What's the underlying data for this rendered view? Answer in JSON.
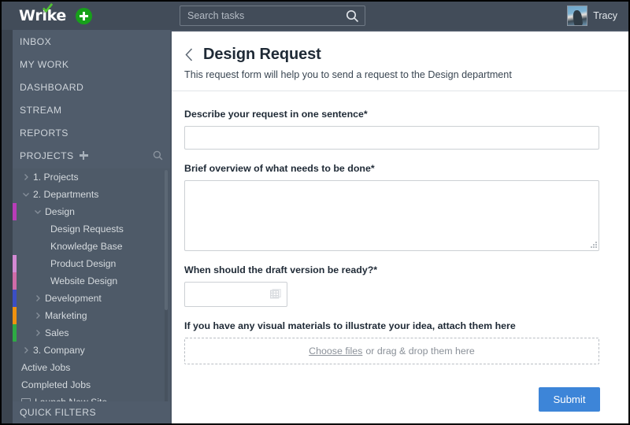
{
  "brand": {
    "logo_text": "Wrike",
    "accent_green": "#17a01a",
    "add_button_label": "+"
  },
  "search": {
    "placeholder": "Search tasks",
    "value": "",
    "icon": "search-icon"
  },
  "user": {
    "name": "Tracy",
    "avatar": "avatar-photo"
  },
  "sidebar": {
    "nav_items": [
      {
        "label": "INBOX"
      },
      {
        "label": "MY WORK"
      },
      {
        "label": "DASHBOARD"
      },
      {
        "label": "STREAM"
      },
      {
        "label": "REPORTS"
      }
    ],
    "projects_row": {
      "label": "PROJECTS",
      "add_icon": "plus-icon",
      "search_icon": "search-icon"
    },
    "tree": [
      {
        "label": "1. Projects",
        "level": 0,
        "chevron": "right",
        "color": ""
      },
      {
        "label": "2. Departments",
        "level": 0,
        "chevron": "down",
        "color": ""
      },
      {
        "label": "Design",
        "level": 1,
        "chevron": "down",
        "color": "#b83db8"
      },
      {
        "label": "Design Requests",
        "level": 2,
        "chevron": "none",
        "color": ""
      },
      {
        "label": "Knowledge Base",
        "level": 2,
        "chevron": "none",
        "color": ""
      },
      {
        "label": "Product Design",
        "level": 2,
        "chevron": "none",
        "color": "#d48ad4"
      },
      {
        "label": "Website Design",
        "level": 2,
        "chevron": "none",
        "color": "#d06ca8"
      },
      {
        "label": "Development",
        "level": 1,
        "chevron": "right",
        "color": "#3b4fc4"
      },
      {
        "label": "Marketing",
        "level": 1,
        "chevron": "right",
        "color": "#f0920f"
      },
      {
        "label": "Sales",
        "level": 1,
        "chevron": "right",
        "color": "#2eab44"
      },
      {
        "label": "3. Company",
        "level": 0,
        "chevron": "right",
        "color": ""
      },
      {
        "label": "Active Jobs",
        "level": 0,
        "chevron": "none",
        "color": ""
      },
      {
        "label": "Completed Jobs",
        "level": 0,
        "chevron": "none",
        "color": ""
      },
      {
        "label": "Launch New Site",
        "level": 0,
        "chevron": "folder",
        "color": ""
      }
    ],
    "quick_filters_label": "QUICK FILTERS"
  },
  "main": {
    "back_icon": "back-chevron-icon",
    "title": "Design Request",
    "subtitle": "This request form will help you to send a request to the Design department",
    "fields": [
      {
        "id": "describe",
        "label": "Describe your request in one sentence*",
        "type": "text",
        "value": "",
        "placeholder": ""
      },
      {
        "id": "overview",
        "label": "Brief overview of what needs to be done*",
        "type": "textarea",
        "value": "",
        "placeholder": ""
      },
      {
        "id": "draft_date",
        "label": "When should the draft version be ready?*",
        "type": "date",
        "value": "",
        "placeholder": "",
        "icon": "calendar-icon"
      },
      {
        "id": "attachments",
        "label": "If you have any visual materials to illustrate your idea, attach them here",
        "type": "dropzone",
        "choose_label": "Choose files",
        "drop_hint": "or drag & drop them here"
      }
    ],
    "submit_label": "Submit",
    "submit_color": "#3d85d8"
  }
}
